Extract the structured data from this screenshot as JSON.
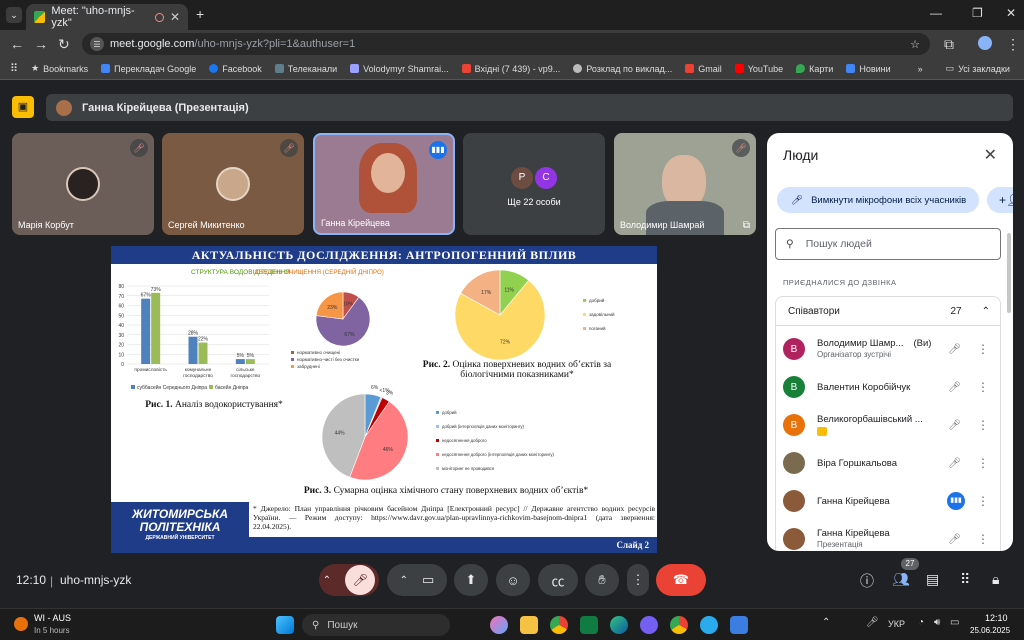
{
  "browser": {
    "tab_title": "Meet: \"uho-mnjs-yzk\"",
    "url_host": "meet.google.com",
    "url_path": "/uho-mnjs-yzk?pli=1&authuser=1",
    "bookmarks": [
      "Bookmarks",
      "Перекладач Google",
      "Facebook",
      "Телеканали",
      "Volodymyr Shamrai...",
      "Вхідні (7 439) - vp9...",
      "Розклад по виклад...",
      "Gmail",
      "YouTube",
      "Карти",
      "Новини"
    ],
    "all_bookmarks": "Усі закладки"
  },
  "meet": {
    "presenter_label": "Ганна Кірейцева (Презентація)",
    "tiles": [
      {
        "name": "Марія Корбут"
      },
      {
        "name": "Сергей Микитенко"
      },
      {
        "name": "Ганна Кірейцева"
      },
      {
        "name": "Ще 22 особи",
        "initials": [
          "P",
          "C"
        ]
      },
      {
        "name": "Володимир Шамрай"
      }
    ],
    "meeting_code": "uho-mnjs-yzk",
    "time": "12:10",
    "participants_count": "27"
  },
  "slide": {
    "title": "АКТУАЛЬНІСТЬ ДОСЛІДЖЕННЯ: АНТРОПОГЕННИЙ ВПЛИВ",
    "fig1_caption_bold": "Рис. 1.",
    "fig1_caption": " Аналіз водокористування*",
    "fig2_caption_bold": "Рис. 2.",
    "fig2_caption": " Оцінка поверхневих водних об’єктів за біологічними показниками*",
    "fig3_caption_bold": "Рис. 3.",
    "fig3_caption": " Сумарна оцінка хімічного стану поверхневих водних об’єктів*",
    "footnote": "* Джерело: План управління річковим басейном Дніпра [Електронний ресурс] // Державне агентство водних ресурсів України. — Режим доступу: https://www.davr.gov.ua/plan-upravlinnya-richkovim-basejnom-dnipra1 (дата звернення: 22.04.2025).",
    "logo_line1": "ЖИТОМИРСЬКА",
    "logo_line2": "ПОЛІТЕХНІКА",
    "logo_line3": "ДЕРЖАВНИЙ УНІВЕРСИТЕТ",
    "slide_number": "Слайд 2"
  },
  "chart_data": [
    {
      "type": "bar",
      "title": "СТРУКТУРА ВОДОВІДВЕДЕННЯ",
      "categories": [
        "промисловість",
        "комунальне господарство",
        "сільське господарство"
      ],
      "series": [
        {
          "name": "суббасейн Середнього Дніпра",
          "values": [
            67,
            28,
            5
          ],
          "color": "#4f81bd"
        },
        {
          "name": "басейн Дніпра",
          "values": [
            73,
            22,
            5
          ],
          "color": "#9bbb59"
        }
      ],
      "data_labels": [
        [
          "67%",
          "28%",
          "5%"
        ],
        [
          "73%",
          "22%",
          "5%"
        ]
      ],
      "yticks": [
        0,
        10,
        20,
        30,
        40,
        50,
        60,
        70,
        80
      ],
      "ylim": [
        0,
        80
      ]
    },
    {
      "type": "pie",
      "title": "СТУПІНЬ ОЧИЩЕННЯ (СЕРЕДНІЙ ДНІПРО)",
      "slices": [
        {
          "label": "нормативно очищені",
          "value": 10,
          "text": "10%",
          "color": "#c0504d"
        },
        {
          "label": "нормативно-чисті без очистки",
          "value": 67,
          "text": "67%",
          "color": "#8064a2"
        },
        {
          "label": "забруднені",
          "value": 23,
          "text": "23%",
          "color": "#f79646"
        }
      ]
    },
    {
      "type": "pie",
      "slices": [
        {
          "label": "добрий",
          "value": 11,
          "text": "11%",
          "color": "#92d050"
        },
        {
          "label": "задовільний",
          "value": 72,
          "text": "72%",
          "color": "#ffd966"
        },
        {
          "label": "поганий",
          "value": 17,
          "text": "17%",
          "color": "#f4b183"
        }
      ]
    },
    {
      "type": "pie",
      "slices": [
        {
          "label": "добрий",
          "value": 6,
          "text": "6%",
          "color": "#5b9bd5"
        },
        {
          "label": "добрий (інтерполяція даних моніторингу)",
          "value": 0.5,
          "text": "<1%",
          "color": "#9dc3e6"
        },
        {
          "label": "недосягнення доброго",
          "value": 3,
          "text": "3%",
          "color": "#c00000"
        },
        {
          "label": "недосягнення доброго (інтерполяція даних моніторингу)",
          "value": 46,
          "text": "46%",
          "color": "#ff7c80"
        },
        {
          "label": "моніторинг не проводився",
          "value": 44,
          "text": "44%",
          "color": "#bfbfbf"
        }
      ]
    }
  ],
  "panel": {
    "title": "Люди",
    "mute_all": "Вимкнути мікрофони всіх учасників",
    "search_placeholder": "Пошук людей",
    "joined_label": "ПРИЄДНАЛИСЯ ДО ДЗВІНКА",
    "group_label": "Співавтори",
    "group_count": "27",
    "people": [
      {
        "initial": "В",
        "name": "Володимир Шамр...",
        "you": "(Ви)",
        "sub": "Організатор зустрічі",
        "color": "#b0235f"
      },
      {
        "initial": "В",
        "name": "Валентин Коробійчук",
        "sub": "",
        "color": "#188038"
      },
      {
        "initial": "В",
        "name": "Великогорбашівський ...",
        "sub": "",
        "color": "#e8710a"
      },
      {
        "initial": "",
        "name": "Віра Горшкальова",
        "sub": "",
        "color": "#7a6a4f"
      },
      {
        "initial": "",
        "name": "Ганна Кірейцева",
        "sub": "",
        "color": "#8a5a3a"
      },
      {
        "initial": "",
        "name": "Ганна Кірейцева",
        "sub": "Презентація",
        "color": "#8a5a3a"
      }
    ]
  },
  "taskbar": {
    "weather_title": "WI - AUS",
    "weather_sub": "In 5 hours",
    "search": "Пошук",
    "lang": "УКР",
    "time": "12:10",
    "date": "25.06.2025"
  }
}
